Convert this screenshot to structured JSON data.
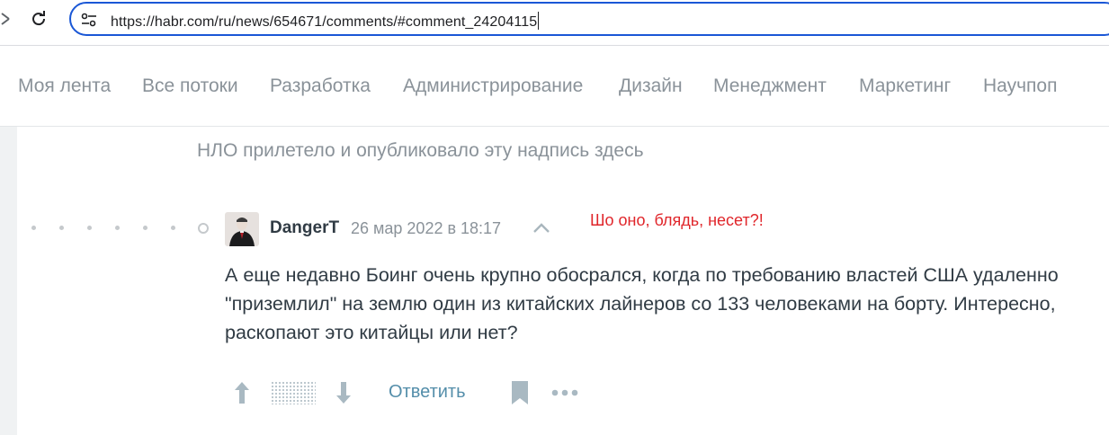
{
  "browser": {
    "url": "https://habr.com/ru/news/654671/comments/#comment_24204115"
  },
  "nav": {
    "items": [
      {
        "label": "Моя лента"
      },
      {
        "label": "Все потоки"
      },
      {
        "label": "Разработка"
      },
      {
        "label": "Администрирование"
      },
      {
        "label": "Дизайн"
      },
      {
        "label": "Менеджмент"
      },
      {
        "label": "Маркетинг"
      },
      {
        "label": "Научпоп"
      }
    ]
  },
  "ufo_note": "НЛО прилетело и опубликовало эту надпись здесь",
  "comment": {
    "author": "DangerT",
    "date": "26 мар 2022 в 18:17",
    "body": "А еще недавно Боинг очень крупно обосрался, когда по требованию властей США удаленно \"приземлил\" на землю один из китайских лайнеров со 133 человеками на борту. Интересно, раскопают это китайцы или нет?",
    "reply_label": "Ответить"
  },
  "annotation": "Шо оно, блядь, несет?!",
  "icons": {
    "back": "back-arrow-icon",
    "reload": "reload-icon",
    "site_info": "tune-icon",
    "parent": "chevron-up-icon",
    "vote_up": "arrow-up-icon",
    "vote_down": "arrow-down-icon",
    "bookmark": "bookmark-icon",
    "more": "more-dots-icon"
  },
  "colors": {
    "omnibox_border": "#1a57d6",
    "nav_text": "#8a9299",
    "link": "#548eaa",
    "annotation": "#e0262b",
    "body_text": "#303b44"
  }
}
